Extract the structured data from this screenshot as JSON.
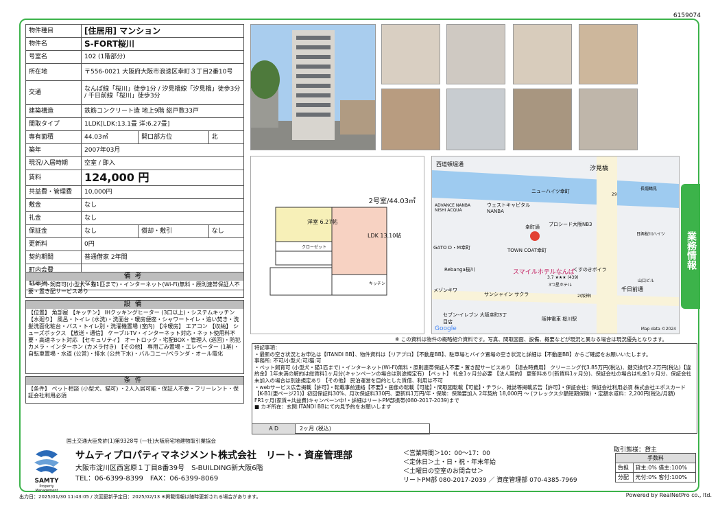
{
  "doc_id": "6159074",
  "spec": [
    {
      "label": "物件種目",
      "value": "[住居用] マンション"
    },
    {
      "label": "物件名",
      "value": "S-FORT桜川"
    },
    {
      "label": "号室名",
      "value": "102 (1階部分)"
    },
    {
      "label": "所在地",
      "value": "〒556-0021 大阪府大阪市浪速区幸町３丁目2番10号"
    },
    {
      "label": "交通",
      "value": "なんば線「桜川」徒歩1分 / 汐見橋線「汐見橋」徒歩3分 / 千日前線「桜川」徒歩3分"
    },
    {
      "label": "建築構造",
      "value": "鉄筋コンクリート造 地上9階 総戸数33戸"
    },
    {
      "label": "間取タイプ",
      "value": "1LDK[LDK:13.1畳 洋:6.27畳]"
    },
    {
      "label": "専有面積",
      "value": "44.03㎡",
      "label2": "開口部方位",
      "value2": "北"
    },
    {
      "label": "築年",
      "value": "2007年03月"
    },
    {
      "label": "現況/入居時期",
      "value": "空室 / 即入"
    },
    {
      "label": "賃料",
      "value": "124,000 円"
    },
    {
      "label": "共益費・管理費",
      "value": "10,000円"
    },
    {
      "label": "敷金",
      "value": "なし"
    },
    {
      "label": "礼金",
      "value": "なし"
    },
    {
      "label": "保証金",
      "value": "なし",
      "label2": "償却・敷引",
      "value2": "なし"
    },
    {
      "label": "更新料",
      "value": "0円"
    },
    {
      "label": "契約期間",
      "value": "普通借家 2年間"
    },
    {
      "label": "町内会費",
      "value": ""
    },
    {
      "label": "駐車場",
      "value": "なし"
    }
  ],
  "bikou": {
    "title": "備考",
    "text": "・ペット飼育可(小型犬・猫1匹まで)・インターネット(Wi-Fi)無料・原則連帯保証人不要・置き配サービスあり"
  },
  "setsubi": {
    "title": "設備",
    "text": "【位置】 角部屋 【キッチン】 IHクッキングヒーター (3口以上)・システムキッチン 【水廻り】 風呂・トイレ (水洗)・洗面台・暖房便座・シャワートイレ・追い焚き・洗髪洗面化粧台・バス・トイレ別・洗濯機置場 (室内) 【冷暖房】 エアコン 【収納】 シューズボックス 【放送・通信】 ケーブルTV・インターネット対応・ネット使用料不要・高速ネット対応 【セキュリティ】 オートロック・宅配BOX・管理人 (巡回)・防犯カメラ・インターホン (カメラ付き) 【その他】 専用ごみ置場・エレベーター (1基)・自転車置場・水道 (公営)・排水 (公共下水)・バルコニー/ベランダ・オール電化"
  },
  "jouken": {
    "title": "条件",
    "text": "【条件】 ペット相談 (小型犬、猫可) ・2人入居可能・保証人不要・フリーレント・保証会社利用必須"
  },
  "floorplan": {
    "title": "2号室/44.03㎡",
    "yoshitsu": "洋室 6.27帖",
    "ldk": "LDK 13.10帖",
    "closet": "クローゼット",
    "kitchen": "キッチン"
  },
  "map": {
    "labels": [
      "西道頓堀通",
      "汐見橋",
      "ニューハイツ幸町",
      "ADVANCE NANBA NISHI ACQUA",
      "ウェストキャピタル NANBA",
      "幸町通",
      "プロシード大阪NB3",
      "TOWN COAT幸町",
      "GATO D・M幸町",
      "Rebanga桜川",
      "スマイルホテルなんば",
      "3.7 ★★★ (439)",
      "3つ星ホテル",
      "くすのきボイラ",
      "メゾンキワ",
      "サンシャイン サクラ",
      "千日前通",
      "2(阪神)",
      "セブン-イレブン 大阪幸町3丁目店",
      "阪神電車 桜川駅",
      "Map data ©2024",
      "Google",
      "29",
      "日興桜川ハイツ",
      "長堀鶴見",
      "山口ビル"
    ]
  },
  "side_tab": "業務情報",
  "disclaimer": "※ この資料は物件の概略紹介資料です。写真、間取図面、設備、概要などが現況と異なる場合は現況優先となります。",
  "notes": "特記事項：\n・最新の空き状況とお申込は【ITANDI BB】、物件資料は【リアプロ】【不動産BB】、駐車場とバイク置場の空き状況と詳細は【不動産BB】からご確認をお願いいたします。\n事務所: 不可/小型犬:可/猫:可\n・ペット飼育可 (小型犬・猫1匹まで)・インターネット(Wi-Fi)無料・原則連帯保証人不要・置き配サービスあり 【退去時費用】 クリーニング代3.85万円(税込)、鍵交換代2.2万円(税込)【違約金】1年未満の解約は総賃料1ヶ月分(キャンペーンの場合は別途規定有) 【ペット】 礼金1ヶ月分必要 【法人契約】 更新料あり(新賃料1ヶ月分)、保証会社の場合は礼金1ヶ月分、保証会社未加入の場合は別途規定あり 【その他】 民泊運営を目的とした賃借、利用は不可\n・webサービス広告掲載【許可】・転載事前連絡【不要】・画像の転載【可能】・間取図転載【可能】・チラシ、雑誌等掲載広告【許可】・保証会社：保証会社利用必須 株式会社エポスカード【K-B1(更ページ21)】初回保証料30%、月次保証料330円、更新料1万円/年・保険：保険要加入 2年契約 18,000円 〜 (フレックス少額短期保険) ・定額水道料：2,200円(税込/月額)\nFR1ヶ月(家賃+共益費)キャンペーン中!・詳細はリートPM部携帯(080-2017-2039)まで\n■ カギ所在：玄関:ITANDI BBにて内見予約をお願いします",
  "ad": {
    "label": "ＡＤ",
    "value": "2ヶ月 (税込)"
  },
  "footer_license": "国土交通大臣免許(1)第9328号 (一社)大阪府宅地建物取引業協会",
  "company": "サムティプロパティマネジメント株式会社　リート・資産管理部",
  "logo_text": "SAMTY",
  "logo_sub": "Property Management",
  "address": "大阪市淀川区西宮原１丁目8番39号　S-BUILDING新大阪6階",
  "phone": "TEL：06-6399-8399　FAX：06-6399-8069",
  "hours": [
    "＜営業時間＞10：00〜17：00",
    "＜定休日＞土・日・祝・年末年始",
    "＜土曜日の空室のお問合せ＞",
    "リートPM部 080-2017-2039 ／ 資産管理部 070-4385-7969"
  ],
  "toriatsukai": "取引態様：貸主",
  "fee": {
    "header": "手数料",
    "rows": [
      {
        "k": "負担",
        "v": "貸主:0% 借主:100%"
      },
      {
        "k": "分配",
        "v": "元付:0% 客付:100%"
      }
    ]
  },
  "output": "出力日：2025/01/30 11:43:05 / 次回更新予定日：2025/02/13 ※掲載情報は随時更新される場合があります。",
  "powered": "Powered by RealNetPro co., ltd."
}
